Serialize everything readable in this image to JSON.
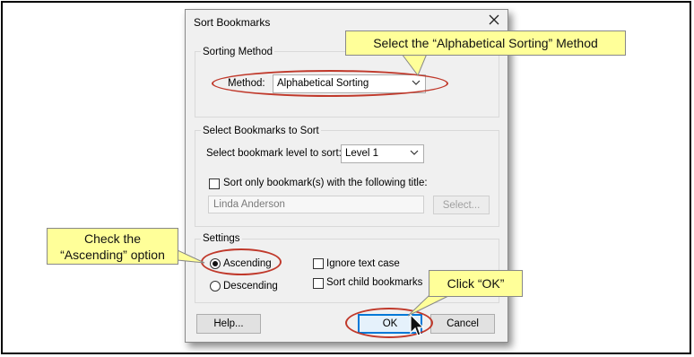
{
  "dialog": {
    "title": "Sort Bookmarks",
    "sorting_method": {
      "group_label": "Sorting Method",
      "method_label": "Method:",
      "method_value": "Alphabetical Sorting"
    },
    "select_bookmarks": {
      "group_label": "Select Bookmarks to Sort",
      "level_label": "Select bookmark level to sort:",
      "level_value": "Level 1",
      "title_checkbox_label": "Sort only bookmark(s) with the following title:",
      "title_value": "Linda Anderson",
      "select_button": "Select..."
    },
    "settings": {
      "group_label": "Settings",
      "ascending": "Ascending",
      "descending": "Descending",
      "ignore_case": "Ignore text case",
      "sort_child": "Sort child bookmarks"
    },
    "buttons": {
      "help": "Help...",
      "ok": "OK",
      "cancel": "Cancel"
    }
  },
  "callouts": {
    "method": "Select the “Alphabetical  Sorting” Method",
    "ascending_line1": "Check the",
    "ascending_line2": "“Ascending” option",
    "ok": "Click “OK”"
  },
  "colors": {
    "callout_fill": "#ffff99",
    "highlight_oval": "#c0392b",
    "default_button_border": "#0078d7"
  },
  "icons": [
    "close-icon",
    "chevron-down-icon",
    "mouse-pointer-icon"
  ]
}
